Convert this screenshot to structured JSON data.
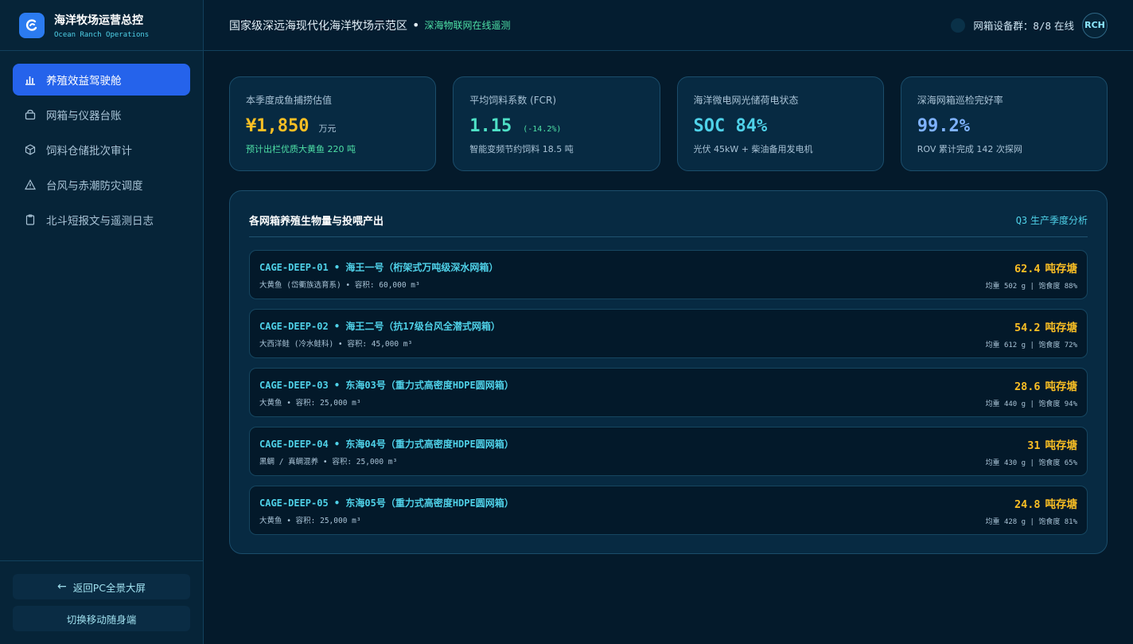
{
  "brand": {
    "title": "海洋牧场运营总控",
    "subtitle": "Ocean Ranch Operations"
  },
  "nav": [
    {
      "label": "养殖效益驾驶舱",
      "icon": "bar-chart-icon",
      "active": true
    },
    {
      "label": "网箱与仪器台账",
      "icon": "archive-icon",
      "active": false
    },
    {
      "label": "饲料仓储批次审计",
      "icon": "box-icon",
      "active": false
    },
    {
      "label": "台风与赤潮防灾调度",
      "icon": "warning-icon",
      "active": false
    },
    {
      "label": "北斗短报文与遥测日志",
      "icon": "clipboard-icon",
      "active": false
    }
  ],
  "footer": {
    "back_label": "返回PC全景大屏",
    "mobile_label": "切换移动随身端"
  },
  "header": {
    "title": "国家级深远海现代化海洋牧场示范区",
    "separator": "•",
    "subtitle": "深海物联网在线遥测",
    "device_label": "网箱设备群：",
    "device_count": "8/8",
    "device_status": "在线",
    "avatar": "RCH"
  },
  "kpis": [
    {
      "label": "本季度成鱼捕捞估值",
      "value": "¥1,850",
      "unit": "万元",
      "delta": "",
      "note": "预计出栏优质大黄鱼 220 吨",
      "value_color": "#fbbf24",
      "note_color": "#4ee0a6"
    },
    {
      "label": "平均饲料系数 (FCR)",
      "value": "1.15",
      "unit": "",
      "delta": "(-14.2%)",
      "note": "智能变频节约饲料 18.5 吨",
      "value_color": "#4ee0c6",
      "note_color": "#a9c3d6"
    },
    {
      "label": "海洋微电网光储荷电状态",
      "value": "SOC 84%",
      "unit": "",
      "delta": "",
      "note": "光伏 45kW + 柴油备用发电机",
      "value_color": "#4fd1e8",
      "note_color": "#a9c3d6"
    },
    {
      "label": "深海网箱巡检完好率",
      "value": "99.2%",
      "unit": "",
      "delta": "",
      "note": "ROV 累计完成 142 次探网",
      "value_color": "#7fb2ff",
      "note_color": "#a9c3d6"
    }
  ],
  "panel": {
    "title": "各网箱养殖生物量与投喂产出",
    "tag_quarter": "Q3",
    "tag_label": "生产季度分析",
    "cages": [
      {
        "name": "CAGE-DEEP-01 • 海王一号（桁架式万吨级深水网箱）",
        "meta": "大黄鱼 (岱衢族选育系) • 容积: 60,000 m³",
        "stock": "62.4",
        "stock_unit": "吨存塘",
        "sub": "均重 502 g | 饱食度 88%"
      },
      {
        "name": "CAGE-DEEP-02 • 海王二号（抗17级台风全潜式网箱）",
        "meta": "大西洋鲑 (冷水鲑科) • 容积: 45,000 m³",
        "stock": "54.2",
        "stock_unit": "吨存塘",
        "sub": "均重 612 g | 饱食度 72%"
      },
      {
        "name": "CAGE-DEEP-03 • 东海03号（重力式高密度HDPE圆网箱）",
        "meta": "大黄鱼 • 容积: 25,000 m³",
        "stock": "28.6",
        "stock_unit": "吨存塘",
        "sub": "均重 440 g | 饱食度 94%"
      },
      {
        "name": "CAGE-DEEP-04 • 东海04号（重力式高密度HDPE圆网箱）",
        "meta": "黑鲷 / 真鲷混养 • 容积: 25,000 m³",
        "stock": "31",
        "stock_unit": "吨存塘",
        "sub": "均重 430 g | 饱食度 65%"
      },
      {
        "name": "CAGE-DEEP-05 • 东海05号（重力式高密度HDPE圆网箱）",
        "meta": "大黄鱼 • 容积: 25,000 m³",
        "stock": "24.8",
        "stock_unit": "吨存塘",
        "sub": "均重 428 g | 饱食度 81%"
      }
    ]
  }
}
